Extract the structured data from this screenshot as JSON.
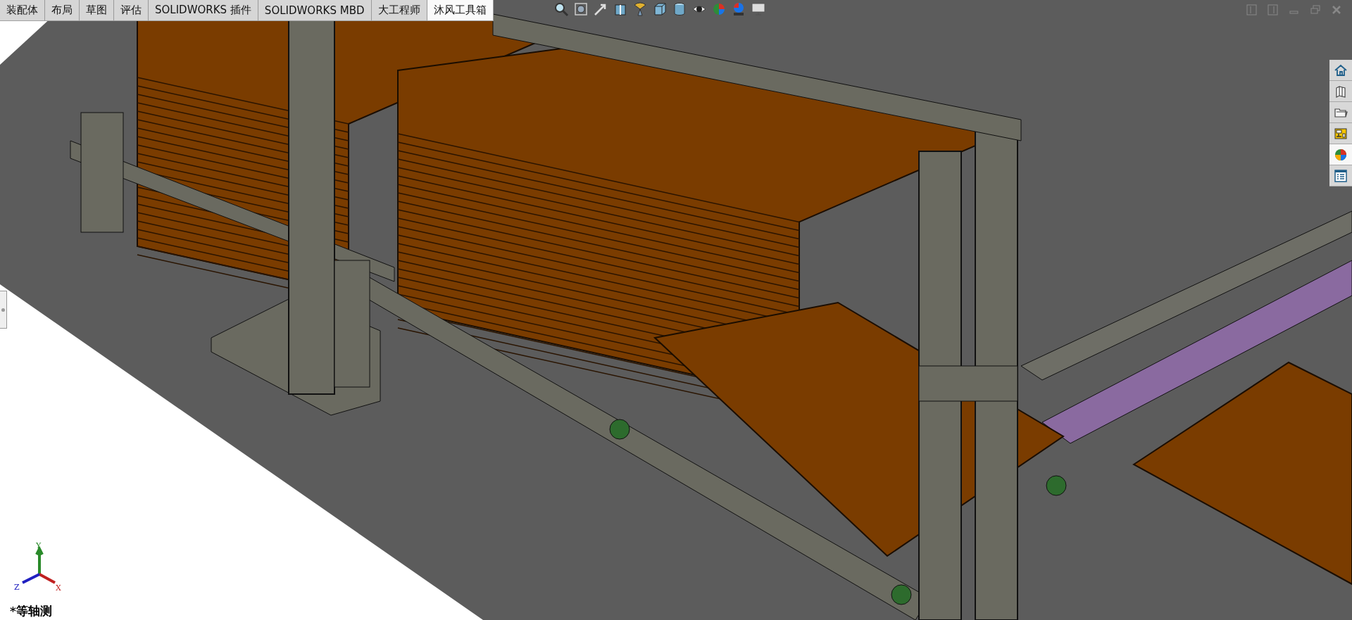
{
  "tabs": [
    {
      "label": "装配体",
      "selected": false
    },
    {
      "label": "布局",
      "selected": false
    },
    {
      "label": "草图",
      "selected": false
    },
    {
      "label": "评估",
      "selected": false
    },
    {
      "label": "SOLIDWORKS 插件",
      "selected": false
    },
    {
      "label": "SOLIDWORKS MBD",
      "selected": false
    },
    {
      "label": "大工程师",
      "selected": false
    },
    {
      "label": "沐风工具箱",
      "selected": true
    }
  ],
  "task_pane": [
    {
      "kind": "home",
      "selected": false
    },
    {
      "kind": "library",
      "selected": false
    },
    {
      "kind": "folder",
      "selected": false
    },
    {
      "kind": "palette",
      "selected": false
    },
    {
      "kind": "appearance",
      "selected": true
    },
    {
      "kind": "properties",
      "selected": false
    }
  ],
  "triad": {
    "y": "Y",
    "x": "X",
    "z": "Z"
  },
  "view_name": "*等轴测"
}
